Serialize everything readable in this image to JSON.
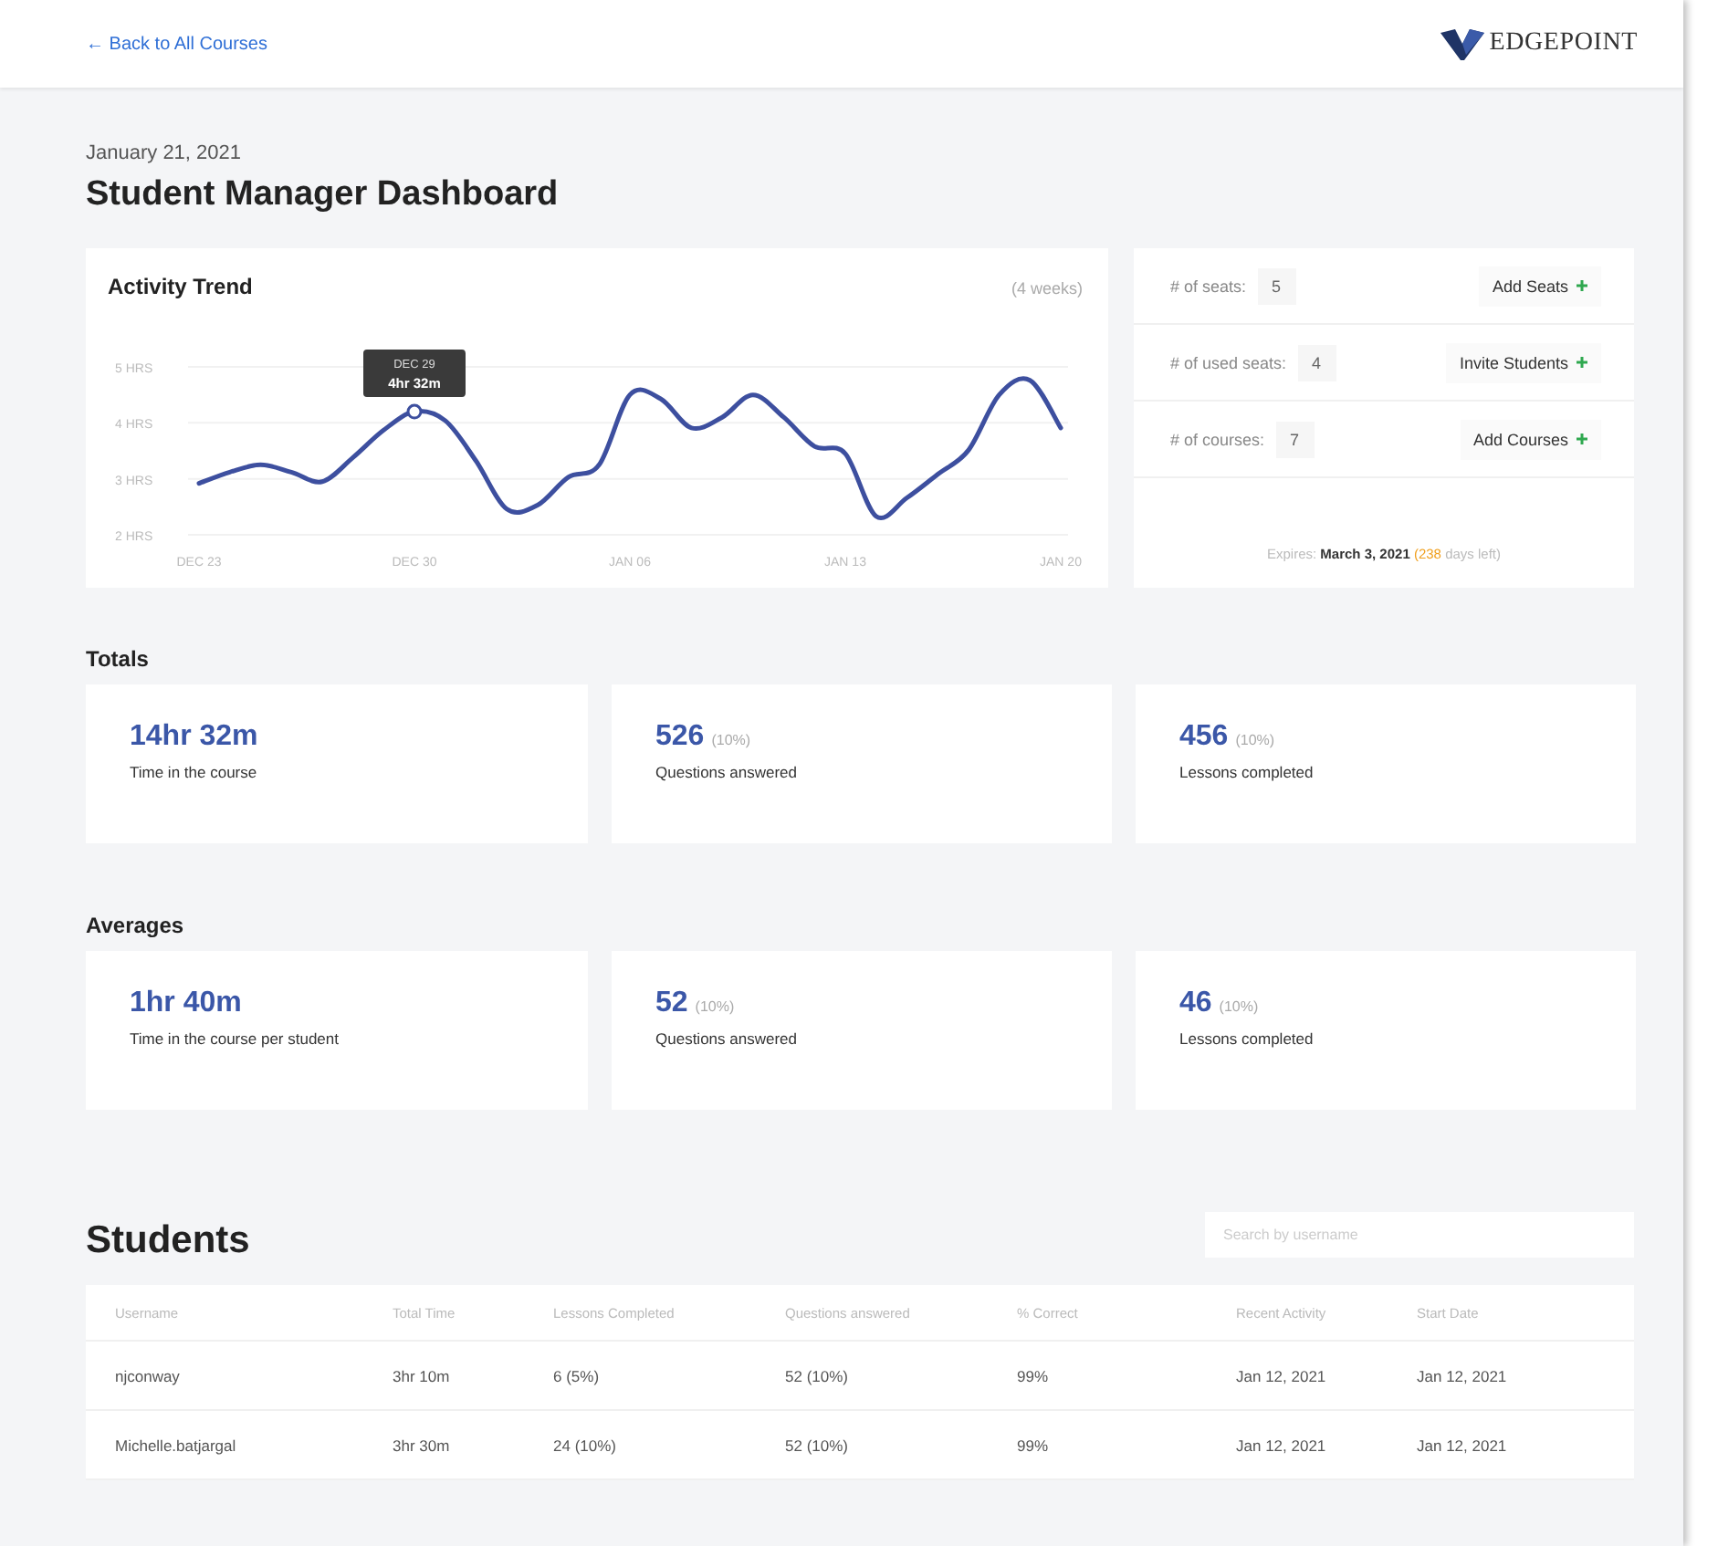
{
  "header": {
    "back_link": "← Back to All Courses",
    "logo_text": "EDGEPOINT"
  },
  "date": "January 21, 2021",
  "title": "Student Manager Dashboard",
  "activity": {
    "title": "Activity Trend",
    "range": "(4 weeks)",
    "chart_data": {
      "type": "line",
      "categories": [
        "DEC 23",
        null,
        null,
        null,
        null,
        null,
        null,
        "DEC 30",
        null,
        null,
        null,
        null,
        null,
        null,
        "JAN 06",
        null,
        null,
        null,
        null,
        null,
        null,
        "JAN 13",
        null,
        null,
        null,
        null,
        null,
        null,
        "JAN 20"
      ],
      "series": [
        {
          "color": "#3d4f9f",
          "values": [
            2.92,
            3.12,
            3.25,
            3.12,
            2.95,
            3.38,
            3.87,
            4.2,
            4.04,
            3.32,
            2.46,
            2.53,
            3.03,
            3.25,
            4.5,
            4.43,
            3.91,
            4.1,
            4.5,
            4.1,
            3.58,
            3.45,
            2.33,
            2.66,
            3.08,
            3.51,
            4.5,
            4.76,
            3.91
          ]
        }
      ],
      "grid": true,
      "ylim": [
        2,
        5
      ],
      "yticks": [
        {
          "value": 5,
          "label": "5 HRS"
        },
        {
          "value": 4,
          "label": "4 HRS"
        },
        {
          "value": 3,
          "label": "3 HRS"
        },
        {
          "value": 2,
          "label": "2 HRS"
        }
      ],
      "annotations": [
        "DEC 29",
        "4hr 32m"
      ]
    }
  },
  "seats": {
    "rows": [
      {
        "label": "# of seats:",
        "value": "5",
        "button": "Add Seats"
      },
      {
        "label": "# of used seats:",
        "value": "4",
        "button": "Invite Students"
      },
      {
        "label": "# of courses:",
        "value": "7",
        "button": "Add Courses"
      }
    ],
    "expires": {
      "label": "Expires:",
      "date": "March 3, 2021",
      "days": "(238",
      "days_text": "days left)"
    }
  },
  "totals": {
    "heading": "Totals",
    "cards": [
      {
        "value": "14hr 32m",
        "label": "Time in the course"
      },
      {
        "value": "526",
        "percent": "(10%)",
        "label": "Questions answered"
      },
      {
        "value": "456",
        "percent": "(10%)",
        "label": "Lessons completed"
      }
    ]
  },
  "averages": {
    "heading": "Averages",
    "cards": [
      {
        "value": "1hr 40m",
        "label": "Time in the course per student"
      },
      {
        "value": "52",
        "percent": "(10%)",
        "label": "Questions answered"
      },
      {
        "value": "46",
        "percent": "(10%)",
        "label": "Lessons completed"
      }
    ]
  },
  "students": {
    "heading": "Students",
    "search": {
      "placeholder": "Search by username"
    },
    "columns": [
      "Username",
      "Total Time",
      "Lessons Completed",
      "Questions answered",
      "% Correct",
      "Recent Activity",
      "Start Date"
    ],
    "rows": [
      [
        "njconway",
        "3hr 10m",
        "6 (5%)",
        "52 (10%)",
        "99%",
        "Jan 12, 2021",
        "Jan 12, 2021"
      ],
      [
        "Michelle.batjargal",
        "3hr 30m",
        "24 (10%)",
        "52 (10%)",
        "99%",
        "Jan 12, 2021",
        "Jan 12, 2021"
      ]
    ]
  }
}
